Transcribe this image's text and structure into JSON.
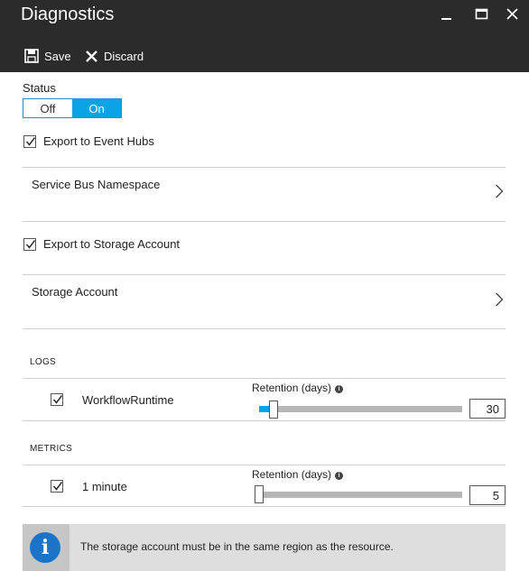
{
  "window": {
    "title": "Diagnostics"
  },
  "toolbar": {
    "save_label": "Save",
    "discard_label": "Discard"
  },
  "status": {
    "label": "Status",
    "off_label": "Off",
    "on_label": "On",
    "selected": "On"
  },
  "event_hubs": {
    "label": "Export to Event Hubs",
    "checked": true,
    "namespace_label": "Service Bus Namespace"
  },
  "storage": {
    "label": "Export to Storage Account",
    "checked": true,
    "account_label": "Storage Account"
  },
  "logs": {
    "header": "LOGS",
    "items": [
      {
        "label": "WorkflowRuntime",
        "checked": true,
        "retention_label": "Retention (days)",
        "retention_value": "30"
      }
    ]
  },
  "metrics": {
    "header": "METRICS",
    "items": [
      {
        "label": "1 minute",
        "checked": true,
        "retention_label": "Retention (days)",
        "retention_value": "5"
      }
    ]
  },
  "info_banner": {
    "icon": "info-icon",
    "text": "The storage account must be in the same region as the resource."
  },
  "colors": {
    "accent": "#0aa4e6",
    "titlebar": "#2b2b2b",
    "banner_bg": "#dedede",
    "info_icon": "#1c74c9"
  }
}
